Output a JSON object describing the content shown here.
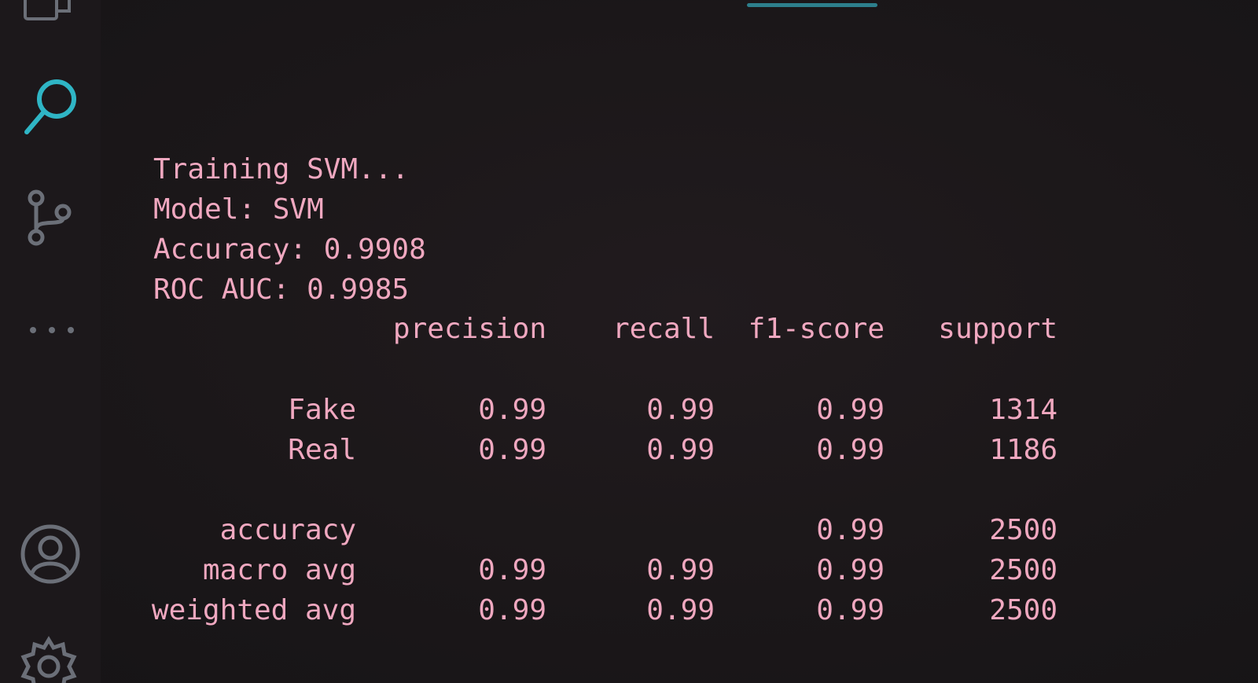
{
  "activity_bar": {
    "icons": [
      "explorer-icon",
      "search-icon",
      "source-control-icon",
      "more-icon",
      "account-icon",
      "settings-icon"
    ],
    "accent_color": "#2fb5c5",
    "icon_color": "#6b6f78"
  },
  "terminal": {
    "text_color": "#f0a8c0",
    "lines": [
      "Training SVM...",
      "Model: SVM",
      "Accuracy: 0.9908",
      "ROC AUC: 0.9985"
    ],
    "report": {
      "headers": [
        "precision",
        "recall",
        "f1-score",
        "support"
      ],
      "rows": [
        {
          "label": "Fake",
          "precision": "0.99",
          "recall": "0.99",
          "f1": "0.99",
          "support": "1314"
        },
        {
          "label": "Real",
          "precision": "0.99",
          "recall": "0.99",
          "f1": "0.99",
          "support": "1186"
        },
        {
          "label": "accuracy",
          "precision": "",
          "recall": "",
          "f1": "0.99",
          "support": "2500"
        },
        {
          "label": "macro avg",
          "precision": "0.99",
          "recall": "0.99",
          "f1": "0.99",
          "support": "2500"
        },
        {
          "label": "weighted avg",
          "precision": "0.99",
          "recall": "0.99",
          "f1": "0.99",
          "support": "2500"
        }
      ]
    }
  }
}
